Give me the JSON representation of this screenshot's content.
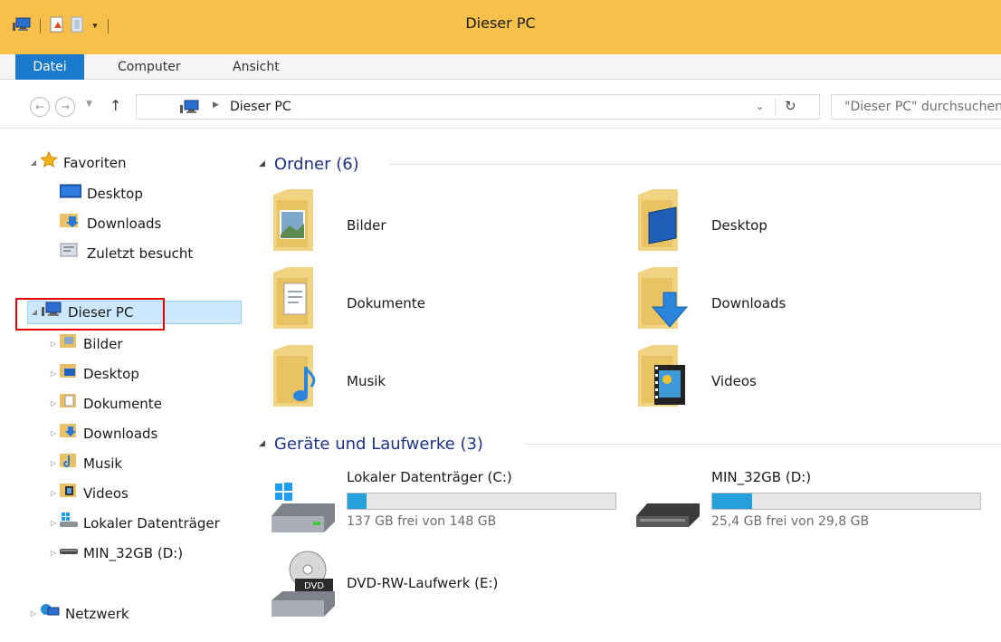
{
  "window": {
    "title": "Dieser PC"
  },
  "ribbon": {
    "tabs": [
      "Datei",
      "Computer",
      "Ansicht"
    ]
  },
  "address": {
    "crumb": "Dieser PC",
    "search_placeholder": "\"Dieser PC\" durchsuchen"
  },
  "nav": {
    "favorites_label": "Favoriten",
    "favorites": [
      "Desktop",
      "Downloads",
      "Zuletzt besucht"
    ],
    "this_pc_label": "Dieser PC",
    "this_pc_children": [
      "Bilder",
      "Desktop",
      "Dokumente",
      "Downloads",
      "Musik",
      "Videos",
      "Lokaler Datenträger",
      "MIN_32GB (D:)"
    ],
    "network_label": "Netzwerk"
  },
  "content": {
    "folders_header": "Ordner (6)",
    "folders": [
      "Bilder",
      "Desktop",
      "Dokumente",
      "Downloads",
      "Musik",
      "Videos"
    ],
    "devices_header": "Geräte und Laufwerke (3)",
    "drives": [
      {
        "name": "Lokaler Datenträger (C:)",
        "free_text": "137 GB frei von 148 GB",
        "used_fraction": 0.07
      },
      {
        "name": "MIN_32GB (D:)",
        "free_text": "25,4 GB frei von 29,8 GB",
        "used_fraction": 0.15
      },
      {
        "name": "DVD-RW-Laufwerk (E:)"
      }
    ]
  },
  "colors": {
    "titlebar": "#f7c04b",
    "file_tab": "#1979ca",
    "group_header": "#1e3287",
    "selection": "#cce8ff",
    "highlight_outline": "#e00000",
    "drive_bar": "#26a0da"
  }
}
